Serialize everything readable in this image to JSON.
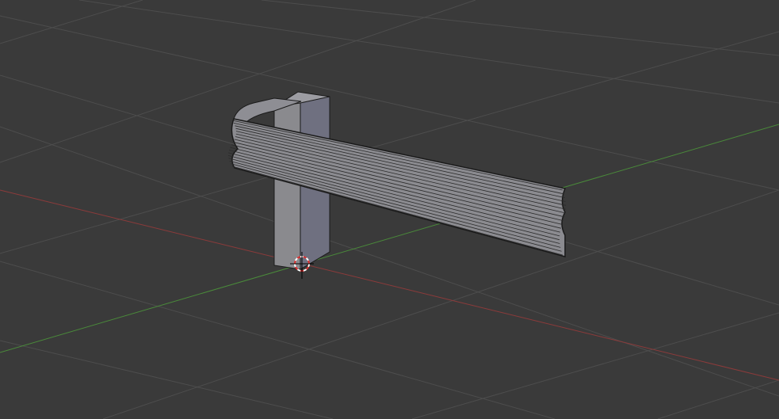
{
  "viewport": {
    "mode": "3d-view",
    "shading": "solid",
    "background_color": "#3a3a3a"
  },
  "grid": {
    "line_color": "#4d4d4d",
    "x_axis_color": "#8c3a3a",
    "y_axis_color": "#4a8a3a"
  },
  "scene": {
    "objects": [
      {
        "name": "guardrail",
        "type": "mesh"
      },
      {
        "name": "post",
        "type": "mesh"
      }
    ],
    "face_colors": {
      "post_front": "#8a8a8e",
      "post_side": "#6f7080",
      "post_top": "#9c9ca2",
      "rail_face": "#8b8b90",
      "edge": "#1a1a1a"
    }
  },
  "cursor_3d": {
    "ring_color_a": "#ffffff",
    "ring_color_b": "#e03030",
    "crosshair_color": "#000000"
  }
}
